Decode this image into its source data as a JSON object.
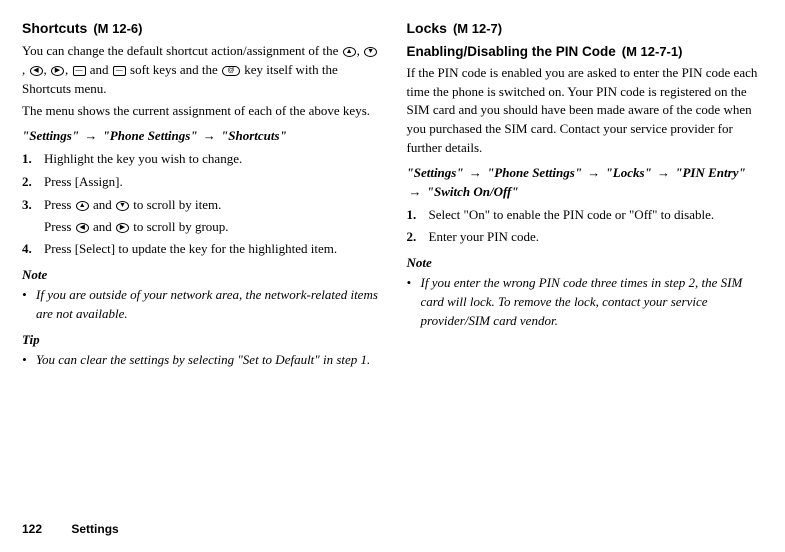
{
  "left": {
    "title": "Shortcuts",
    "mcode": "(M 12-6)",
    "intro_a": "You can change the default shortcut action/assignment of the ",
    "intro_b": " soft keys and the ",
    "intro_c": " key itself with the Shortcuts menu.",
    "intro_and": " and ",
    "para2": "The menu shows the current assignment of each of the above keys.",
    "nav": {
      "p1": "\"Settings\"",
      "p2": "\"Phone Settings\"",
      "p3": "\"Shortcuts\""
    },
    "steps": {
      "s1": "Highlight the key you wish to change.",
      "s2": "Press [Assign].",
      "s3a": "Press ",
      "s3b": " and ",
      "s3c": " to scroll by item.",
      "s3sub_a": "Press ",
      "s3sub_b": " and ",
      "s3sub_c": " to scroll by group.",
      "s4": "Press [Select] to update the key for the highlighted item."
    },
    "note_head": "Note",
    "note_b1": "If you are outside of your network area, the network-related items are not available.",
    "tip_head": "Tip",
    "tip_b1": "You can clear the settings by selecting \"Set to Default\" in step 1."
  },
  "right": {
    "title": "Locks",
    "mcode": "(M 12-7)",
    "sub_title": "Enabling/Disabling the PIN Code",
    "sub_mcode": "(M 12-7-1)",
    "intro": "If the PIN code is enabled you are asked to enter the PIN code each time the phone is switched on. Your PIN code is registered on the SIM card and you should have been made aware of the code when you purchased the SIM card. Contact your service provider for further details.",
    "nav": {
      "p1": "\"Settings\"",
      "p2": "\"Phone Settings\"",
      "p3": "\"Locks\"",
      "p4": "\"PIN Entry\"",
      "p5": "\"Switch On/Off\""
    },
    "steps": {
      "s1": "Select \"On\" to enable the PIN code or \"Off\" to disable.",
      "s2": "Enter your PIN code."
    },
    "note_head": "Note",
    "note_b1": "If you enter the wrong PIN code three times in step 2, the SIM card will lock. To remove the lock, contact your service provider/SIM card vendor."
  },
  "footer": {
    "page": "122",
    "section": "Settings"
  }
}
